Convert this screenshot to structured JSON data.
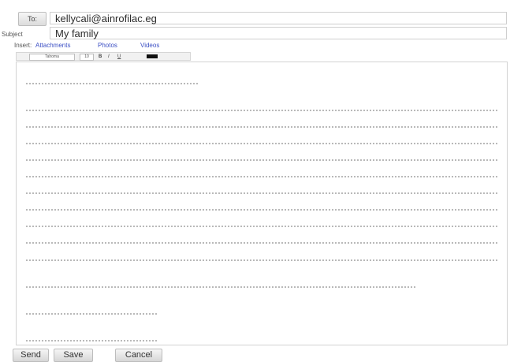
{
  "compose": {
    "to_label": "To:",
    "to_value": "kellycali@ainrofilac.eg",
    "subject_label": "Subject",
    "subject_value": "My family",
    "insert_label": "Insert:",
    "insert_links": [
      "Attachments",
      "Photos",
      "Videos"
    ]
  },
  "toolbar": {
    "font": "Tahoma",
    "size": "10",
    "bold": "B",
    "italic": "I",
    "underline": "U",
    "color_swatch": "#111111"
  },
  "body_placeholder_lines": 13,
  "actions": {
    "send": "Send",
    "save": "Save",
    "cancel": "Cancel"
  }
}
